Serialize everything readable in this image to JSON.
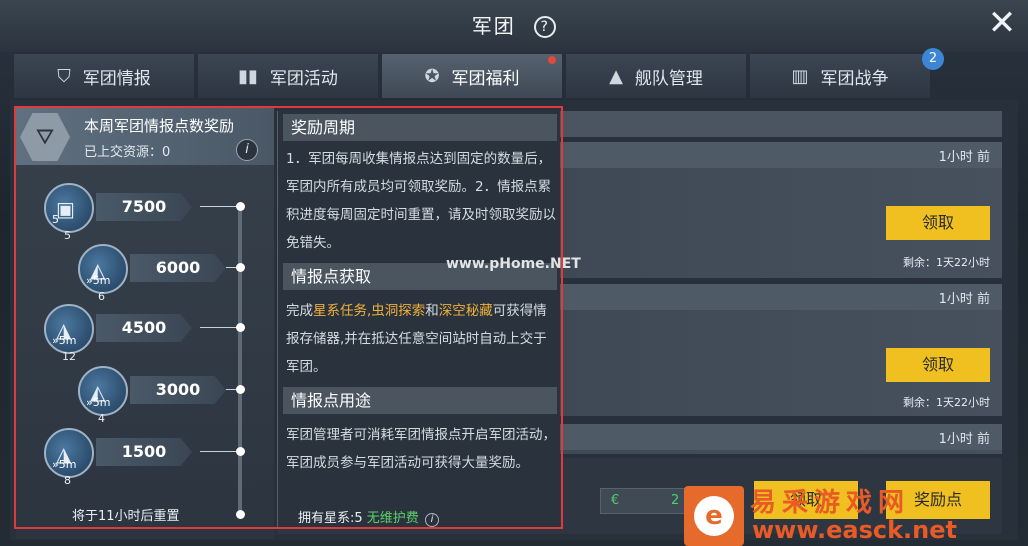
{
  "header": {
    "title": "军团",
    "help_glyph": "?",
    "close_glyph": "✕"
  },
  "tabs": [
    {
      "label": "军团情报",
      "icon": "shield-icon"
    },
    {
      "label": "军团活动",
      "icon": "book-icon"
    },
    {
      "label": "军团福利",
      "icon": "gift-icon",
      "active": true,
      "red_dot": true
    },
    {
      "label": "舰队管理",
      "icon": "fleet-icon"
    },
    {
      "label": "军团战争",
      "icon": "war-icon",
      "badge": "2"
    }
  ],
  "reward_panel": {
    "title": "本周军团情报点数奖励",
    "submitted": "已上交资源：0",
    "info_glyph": "i",
    "tiers": [
      {
        "points": "7500",
        "tag": "5",
        "count": "5"
      },
      {
        "points": "6000",
        "tag": "»5m",
        "count": "6"
      },
      {
        "points": "4500",
        "tag": "»5m",
        "count": "12"
      },
      {
        "points": "3000",
        "tag": "»5m",
        "count": "4"
      },
      {
        "points": "1500",
        "tag": "»5m",
        "count": "8"
      }
    ],
    "reset_note": "将于11小时后重置"
  },
  "popup": {
    "sections": [
      {
        "heading": "奖励周期"
      },
      {
        "heading": "情报点获取"
      },
      {
        "heading": "情报点用途"
      }
    ],
    "cycle_text": "1．军团每周收集情报点达到固定的数量后，军团内所有成员均可领取奖励。2．情报点累积进度每周固定时间重置，请及时领取奖励以免错失。",
    "acquire_prefix": "完成",
    "acquire_h1": "星系任务",
    "acquire_sep1": ",",
    "acquire_h2": "虫洞探索",
    "acquire_sep2": "和",
    "acquire_h3": "深空秘藏",
    "acquire_suffix": "可获得情报存储器,并在抵达任意空间站时自动上交于军团。",
    "usage_text": "军团管理者可消耗军团情报点开启军团活动，军团成员参与军团活动可获得大量奖励。"
  },
  "rewards_list": [
    {
      "time": "1小时 前",
      "button": "领取",
      "remain": "剩余：1天22小时"
    },
    {
      "time": "1小时 前",
      "button": "领取",
      "remain": "剩余：1天22小时"
    },
    {
      "time": "1小时 前"
    }
  ],
  "bottom": {
    "owned_label": "拥有星系:5",
    "owned_status": "无维护费",
    "info_glyph": "i",
    "credit_symbol": "€",
    "credit_value": "2",
    "button1": "领取",
    "button2": "奖励点"
  },
  "watermarks": {
    "site_mark": "www.pHome.NET",
    "easck_line1": "易采游戏网",
    "easck_line2": "www.easck.net",
    "easck_logo": "e"
  },
  "colors": {
    "accent_gold": "#f0c020",
    "highlight": "#f0b03a",
    "alert_red": "#e04a3a",
    "badge_blue": "#3d86d6",
    "frame_red": "#e03a3a"
  }
}
